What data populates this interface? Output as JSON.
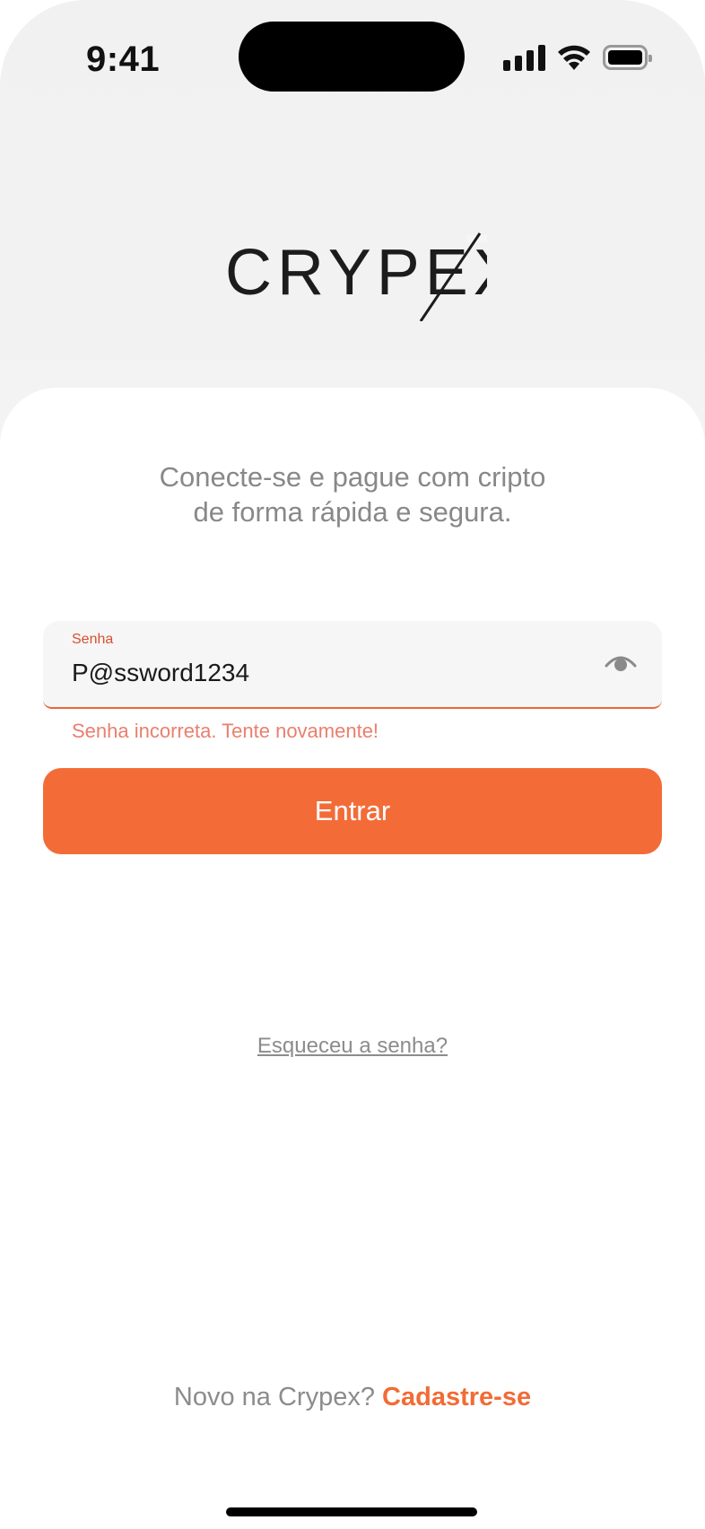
{
  "status_bar": {
    "time": "9:41"
  },
  "logo": {
    "text": "CRYPEX"
  },
  "tagline": {
    "line1": "Conecte-se e pague com cripto",
    "line2": "de forma rápida e segura."
  },
  "password_field": {
    "label": "Senha",
    "value": "P@ssword1234",
    "error": "Senha incorreta. Tente novamente!"
  },
  "login_button": {
    "label": "Entrar"
  },
  "forgot_link": {
    "label": "Esqueceu a senha?"
  },
  "signup": {
    "prompt": "Novo na Crypex?",
    "link": "Cadastre-se"
  },
  "colors": {
    "accent": "#f36c38",
    "error": "#ea7f6e",
    "muted_text": "#8c8c8c"
  },
  "icons": {
    "eye": "eye-icon",
    "signal": "cellular-signal-icon",
    "wifi": "wifi-icon",
    "battery": "battery-icon"
  }
}
